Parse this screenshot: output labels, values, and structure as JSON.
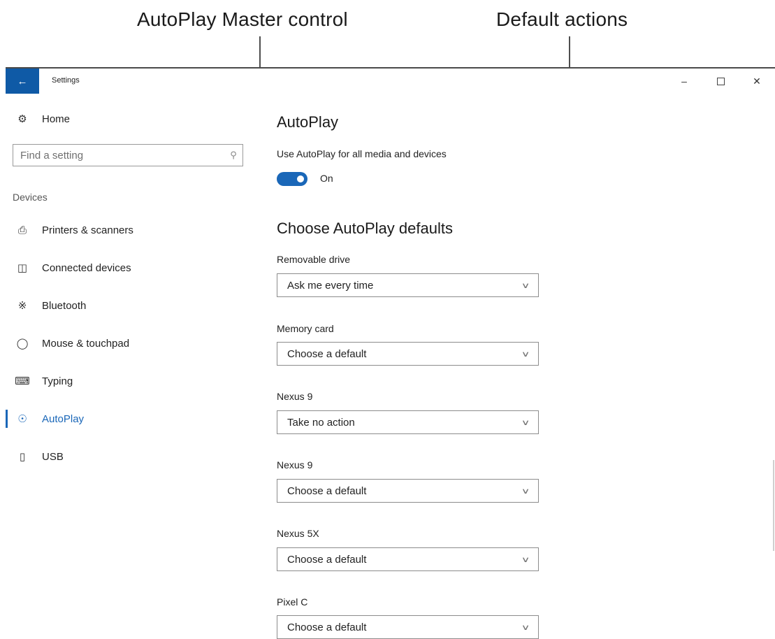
{
  "annotations": {
    "master_control": "AutoPlay Master control",
    "default_actions": "Default actions"
  },
  "window": {
    "title": "Settings",
    "back_icon": "arrow-left-icon",
    "controls": [
      "minimize-icon",
      "maximize-icon",
      "close-icon"
    ]
  },
  "sidebar": {
    "home": {
      "label": "Home",
      "icon": "gear-icon"
    },
    "search": {
      "placeholder": "Find a setting",
      "icon": "search-icon"
    },
    "section": "Devices",
    "items": [
      {
        "label": "Printers & scanners",
        "icon": "printer-icon",
        "active": false
      },
      {
        "label": "Connected devices",
        "icon": "devices-icon",
        "active": false
      },
      {
        "label": "Bluetooth",
        "icon": "bluetooth-icon",
        "active": false
      },
      {
        "label": "Mouse & touchpad",
        "icon": "mouse-icon",
        "active": false
      },
      {
        "label": "Typing",
        "icon": "keyboard-icon",
        "active": false
      },
      {
        "label": "AutoPlay",
        "icon": "autoplay-icon",
        "active": true
      },
      {
        "label": "USB",
        "icon": "usb-icon",
        "active": false
      }
    ]
  },
  "main": {
    "title": "AutoPlay",
    "master_toggle": {
      "label": "Use AutoPlay for all media and devices",
      "state": "On",
      "on": true
    },
    "defaults_heading": "Choose AutoPlay defaults",
    "defaults": [
      {
        "label": "Removable drive",
        "value": "Ask me every time"
      },
      {
        "label": "Memory card",
        "value": "Choose a default"
      },
      {
        "label": "Nexus 9",
        "value": "Take no action"
      },
      {
        "label": "Nexus 9",
        "value": "Choose a default"
      },
      {
        "label": "Nexus 5X",
        "value": "Choose a default"
      },
      {
        "label": "Pixel C",
        "value": "Choose a default"
      }
    ]
  },
  "colors": {
    "accent": "#1a67b8",
    "back_button": "#0f5aa6"
  }
}
